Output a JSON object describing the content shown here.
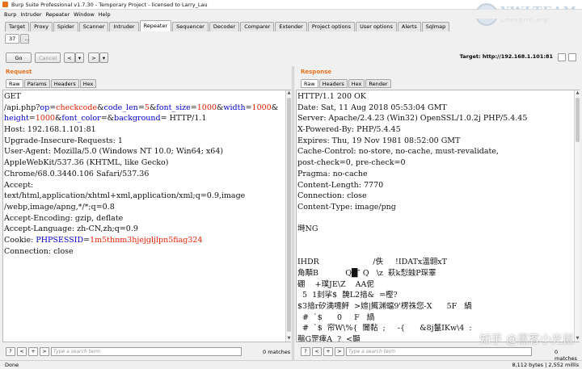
{
  "window": {
    "title": "Burp Suite Professional v1.7.30 - Temporary Project - licensed to Larry_Lau"
  },
  "watermark": {
    "big": "YWLTEAM",
    "small": "ChangYin.org"
  },
  "menu": [
    "Burp",
    "Intruder",
    "Repeater",
    "Window",
    "Help"
  ],
  "tabs": [
    "Target",
    "Proxy",
    "Spider",
    "Scanner",
    "Intruder",
    "Repeater",
    "Sequencer",
    "Decoder",
    "Comparer",
    "Extender",
    "Project options",
    "User options",
    "Alerts",
    "Sqlmap"
  ],
  "active_tab": "Repeater",
  "subtabs": [
    "37",
    "..."
  ],
  "toolbar": {
    "go": "Go",
    "cancel": "Cancel",
    "back": "<",
    "back_menu": "▾",
    "fwd": ">",
    "fwd_menu": "▾",
    "target_label": "Target: http://192.168.1.101:81"
  },
  "request": {
    "heading": "Request",
    "tabs": [
      "Raw",
      "Params",
      "Headers",
      "Hex"
    ],
    "lines": [
      {
        "segs": [
          [
            "t",
            "GET"
          ]
        ]
      },
      {
        "segs": [
          [
            "t",
            "/api.php?"
          ],
          [
            "p",
            "op"
          ],
          [
            "t",
            "="
          ],
          [
            "v",
            "checkcode"
          ],
          [
            "t",
            "&"
          ],
          [
            "p",
            "code_len"
          ],
          [
            "t",
            "="
          ],
          [
            "v",
            "5"
          ],
          [
            "t",
            "&"
          ],
          [
            "p",
            "font_size"
          ],
          [
            "t",
            "="
          ],
          [
            "v",
            "1000"
          ],
          [
            "t",
            "&"
          ],
          [
            "p",
            "width"
          ],
          [
            "t",
            "="
          ],
          [
            "v",
            "1000"
          ],
          [
            "t",
            "&"
          ]
        ]
      },
      {
        "segs": [
          [
            "p",
            "height"
          ],
          [
            "t",
            "="
          ],
          [
            "v",
            "1000"
          ],
          [
            "t",
            "&"
          ],
          [
            "p",
            "font_color"
          ],
          [
            "t",
            "="
          ],
          [
            "t",
            "&"
          ],
          [
            "p",
            "background"
          ],
          [
            "t",
            "= HTTP/1.1"
          ]
        ]
      },
      {
        "segs": [
          [
            "t",
            "Host: 192.168.1.101:81"
          ]
        ]
      },
      {
        "segs": [
          [
            "t",
            "Upgrade-Insecure-Requests: 1"
          ]
        ]
      },
      {
        "segs": [
          [
            "t",
            "User-Agent: Mozilla/5.0 (Windows NT 10.0; Win64; x64)"
          ]
        ]
      },
      {
        "segs": [
          [
            "t",
            "AppleWebKit/537.36 (KHTML, like Gecko)"
          ]
        ]
      },
      {
        "segs": [
          [
            "t",
            "Chrome/68.0.3440.106 Safari/537.36"
          ]
        ]
      },
      {
        "segs": [
          [
            "t",
            "Accept:"
          ]
        ]
      },
      {
        "segs": [
          [
            "t",
            "text/html,application/xhtml+xml,application/xml;q=0.9,image"
          ]
        ]
      },
      {
        "segs": [
          [
            "t",
            "/webp,image/apng,*/*;q=0.8"
          ]
        ]
      },
      {
        "segs": [
          [
            "t",
            "Accept-Encoding: gzip, deflate"
          ]
        ]
      },
      {
        "segs": [
          [
            "t",
            "Accept-Language: zh-CN,zh;q=0.9"
          ]
        ]
      },
      {
        "segs": [
          [
            "t",
            "Cookie: "
          ],
          [
            "p",
            "PHPSESSID"
          ],
          [
            "t",
            "="
          ],
          [
            "v",
            "1m5thnm3hjejgljlpn5fiag324"
          ]
        ]
      },
      {
        "segs": [
          [
            "t",
            "Connection: close"
          ]
        ]
      }
    ],
    "search_placeholder": "Type a search term",
    "matches": "0 matches"
  },
  "response": {
    "heading": "Response",
    "tabs": [
      "Raw",
      "Headers",
      "Hex",
      "Render"
    ],
    "lines": [
      "HTTP/1.1 200 OK",
      "Date: Sat, 11 Aug 2018 05:53:04 GMT",
      "Server: Apache/2.4.23 (Win32) OpenSSL/1.0.2j PHP/5.4.45",
      "X-Powered-By: PHP/5.4.45",
      "Expires: Thu, 19 Nov 1981 08:52:00 GMT",
      "Cache-Control: no-store, no-cache, must-revalidate,",
      "post-check=0, pre-check=0",
      "Pragma: no-cache",
      "Content-Length: 7770",
      "Connection: close",
      "Content-Type: image/png",
      "",
      "塒NG",
      "",
      "",
      "IHDR                      /佚     !IDATx溫翶xT",
      "角顒B           Q█″ Q   \\z  萩k悡鉵P琛睪",
      "硼    +璞JE\\Z    AA伲",
      "  5  1刲挲$  馣L2揞&  =樫?",
      "$3揞r矽満嚏鮃  >媗|鮿渊蟷9'楞祩您-X      5F   緺",
      "  #  `$      0     F   緺",
      "  #  `$  帘W\\%{  闐黏  ;     -{      &8j鬣IKw\\4  :",
      "䴏G罡瘞A  ?  <顯"
    ],
    "search_placeholder": "Type a search term",
    "matches": "0 matches"
  },
  "status": {
    "left": "Done",
    "right": "8,112 bytes | 2,552 millis"
  },
  "overlay": {
    "zhihu": "知乎 @黑客小光鼠"
  }
}
